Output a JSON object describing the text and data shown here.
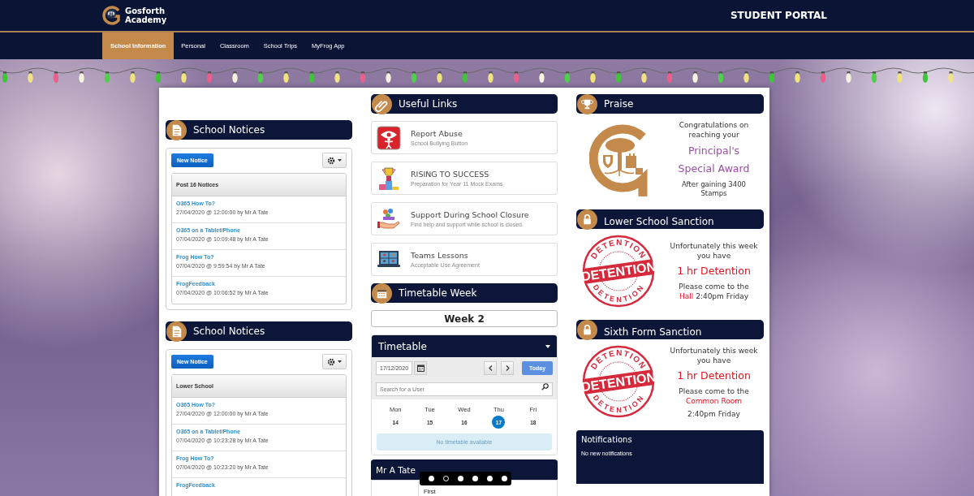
{
  "header": {
    "school_name": "Gosforth Academy",
    "portal_title": "STUDENT PORTAL"
  },
  "nav": [
    {
      "label": "School Information",
      "selected": true
    },
    {
      "label": "Personal",
      "selected": false
    },
    {
      "label": "Classroom",
      "selected": false
    },
    {
      "label": "School Trips",
      "selected": false
    },
    {
      "label": "MyFrog App",
      "selected": false
    }
  ],
  "notices": [
    {
      "title": "School Notices",
      "button": "New Notice",
      "list_title": "Post 16 Notices",
      "items": [
        {
          "title": "O365 How To?",
          "meta": "27/04/2020 @ 12:00:00 by Mr A Tate"
        },
        {
          "title": "O365 on a Tablet/Phone",
          "meta": "07/04/2020 @ 10:09:48 by Mr A Tate"
        },
        {
          "title": "Frog How To?",
          "meta": "07/04/2020 @ 9:59:54 by Mr A Tate"
        },
        {
          "title": "FrogFeedback",
          "meta": "07/04/2020 @ 10:06:52 by Mr A Tate"
        }
      ]
    },
    {
      "title": "School Notices",
      "button": "New Notice",
      "list_title": "Lower School",
      "items": [
        {
          "title": "O365 How To?",
          "meta": "27/04/2020 @ 12:00:00 by Mr A Tate"
        },
        {
          "title": "O365 on a Tablet/Phone",
          "meta": "07/04/2020 @ 10:23:28 by Mr A Tate"
        },
        {
          "title": "Frog How To?",
          "meta": "07/04/2020 @ 10:23:20 by Mr A Tate"
        },
        {
          "title": "FrogFeedback"
        }
      ]
    }
  ],
  "useful_links": {
    "title": "Useful Links",
    "links": [
      {
        "title": "Report Abuse",
        "subtitle": "School Bullying Button"
      },
      {
        "title": "RISING TO SUCCESS",
        "subtitle": "Preparation for Year 11 Mock Exams"
      },
      {
        "title": "Support During School Closure",
        "subtitle": "Find help and support while school is closed."
      },
      {
        "title": "Teams Lessons",
        "subtitle": "Acceptable Use Agreement"
      }
    ]
  },
  "timetable_week": {
    "title": "Timetable Week",
    "week": "Week 2"
  },
  "timetable": {
    "title": "Timetable",
    "date": "17/12/2020",
    "today": "Today",
    "search_placeholder": "Search for a User",
    "days": [
      {
        "name": "Mon",
        "date": "14",
        "selected": false
      },
      {
        "name": "Tue",
        "date": "15",
        "selected": false
      },
      {
        "name": "Wed",
        "date": "16",
        "selected": false
      },
      {
        "name": "Thu",
        "date": "17",
        "selected": true
      },
      {
        "name": "Fri",
        "date": "18",
        "selected": false
      }
    ],
    "empty_message": "No timetable available"
  },
  "profile": {
    "title": "Mr A Tate",
    "row_label": "First"
  },
  "praise": {
    "title": "Praise",
    "message": "Congratulations on reaching your",
    "award": "Principal's Special Award",
    "footer": "After gaining 3400 Stamps"
  },
  "sanctions": [
    {
      "title": "Lower School Sanction",
      "stamp_top": "DETENTION",
      "stamp_band": "DETENTION",
      "stamp_bottom": "DETENTION",
      "intro": "Unfortunately this week you have",
      "detention": "1 hr Detention",
      "message": "Please come to the **Hall** 2:40pm Friday"
    },
    {
      "title": "Sixth Form Sanction",
      "stamp_top": "DETENTION",
      "stamp_band": "DETENTION",
      "stamp_bottom": "DETENTION",
      "intro": "Unfortunately this week you have",
      "detention": "1 hr Detention",
      "message": "Please come to the **Common Room**",
      "time": "2:40pm Friday"
    }
  ],
  "notifications": {
    "title": "Notifications",
    "message": "No new notifications"
  },
  "carousel": {
    "dots": [
      {
        "selected": false
      },
      {
        "selected": true
      },
      {
        "selected": false
      },
      {
        "selected": false
      },
      {
        "selected": false
      },
      {
        "selected": false
      }
    ]
  }
}
